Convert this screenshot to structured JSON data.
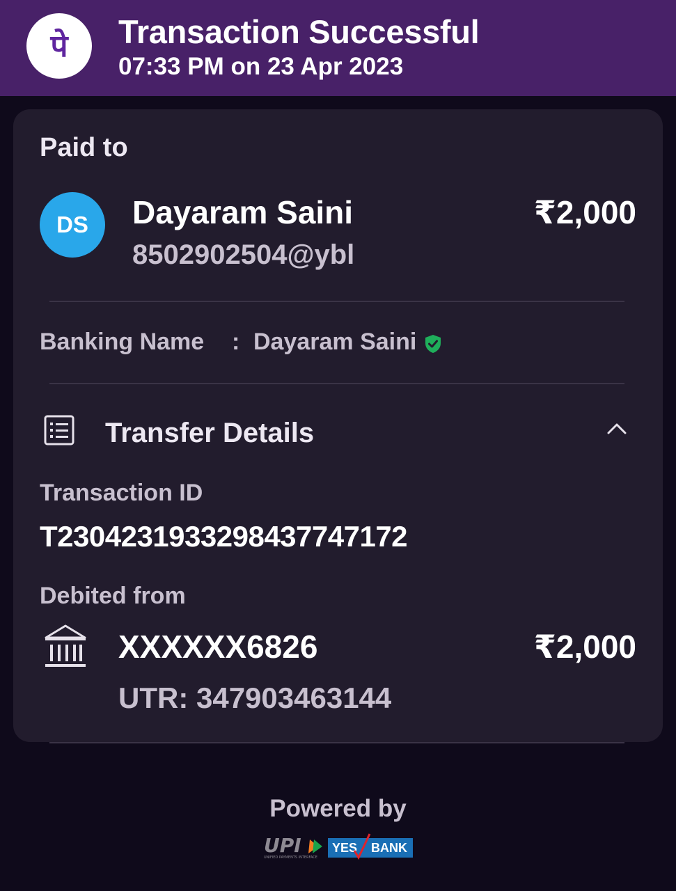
{
  "header": {
    "title": "Transaction Successful",
    "datetime": "07:33 PM on 23 Apr 2023",
    "logo_icon": "phonepe-logo-icon",
    "logo_glyph": "पे"
  },
  "payee": {
    "section_label": "Paid to",
    "avatar_initials": "DS",
    "name": "Dayaram Saini",
    "upi_id": "8502902504@ybl",
    "amount": "₹2,000"
  },
  "banking_name": {
    "label": "Banking Name",
    "separator": ":",
    "value": "Dayaram Saini",
    "verified_icon": "verified-shield-icon"
  },
  "transfer_details": {
    "title": "Transfer Details",
    "icon": "receipt-list-icon",
    "toggle_icon": "chevron-up-icon",
    "transaction_id_label": "Transaction ID",
    "transaction_id": "T2304231933298437747172",
    "debited_from_label": "Debited from",
    "bank_icon": "bank-icon",
    "account": "XXXXXX6826",
    "amount": "₹2,000",
    "utr": "UTR: 347903463144"
  },
  "footer": {
    "powered_by": "Powered by",
    "upi_text": "UPI",
    "upi_tagline": "UNIFIED PAYMENTS INTERFACE",
    "bank_part1": "YES",
    "bank_part2": "BANK"
  },
  "colors": {
    "header_bg": "#482168",
    "page_bg": "#0f0a1b",
    "card_bg": "#221c2d",
    "avatar_bg": "#29a7ea",
    "verified": "#1fae5b",
    "brand_purple": "#5f259f"
  }
}
